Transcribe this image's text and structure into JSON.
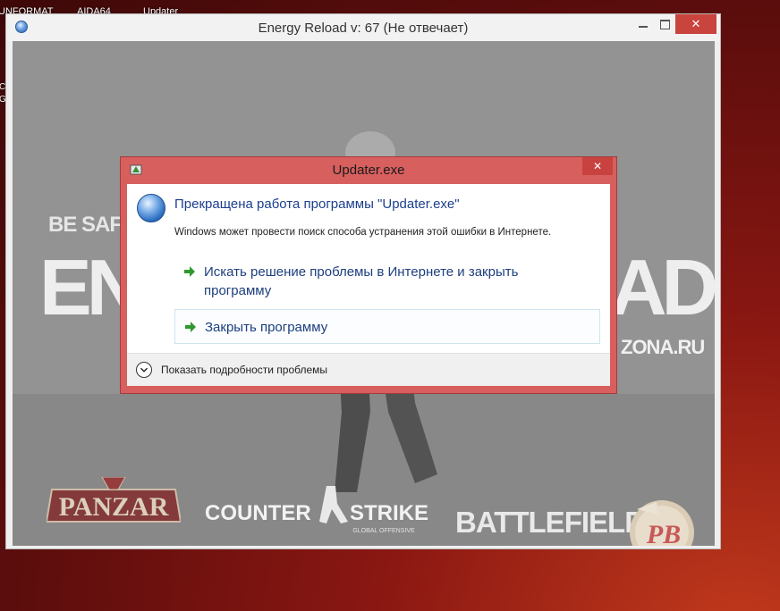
{
  "desktop": {
    "top_labels": [
      "UNFORMAT",
      "AIDA64",
      "Updater"
    ],
    "side_labels": [
      "Co",
      "Gl"
    ]
  },
  "main_window": {
    "title": "Energy Reload v: 67 (Не отвечает)",
    "controls": {
      "minimize_icon": "minimize-icon",
      "maximize_icon": "maximize-icon",
      "close": "✕"
    },
    "banner": {
      "slogan": "BE SAFE",
      "title_left": "EN",
      "title_right": "AD",
      "site": "ZONA.RU"
    },
    "game_logos": {
      "panzar": "PANZAR",
      "counter_strike": "COUNTER",
      "counter_strike_b": "STRIKE",
      "counter_strike_sub": "GLOBAL OFFENSIVE",
      "battlefield": "BATTLEFIELD",
      "pb": "PB"
    }
  },
  "error_dialog": {
    "title": "Updater.exe",
    "close": "✕",
    "headline": "Прекращена работа программы \"Updater.exe\"",
    "subtext": "Windows может провести поиск способа устранения этой ошибки в Интернете.",
    "options": [
      {
        "label_line1": "Искать решение проблемы в Интернете и закрыть",
        "label_line2": "программу"
      },
      {
        "label": "Закрыть программу"
      }
    ],
    "details_toggle": "Показать подробности проблемы"
  },
  "colors": {
    "dialog_frame": "#d75f5e",
    "close_button": "#c9443c",
    "link_text": "#1d3f7e",
    "arrow_green": "#2e9a2e"
  }
}
